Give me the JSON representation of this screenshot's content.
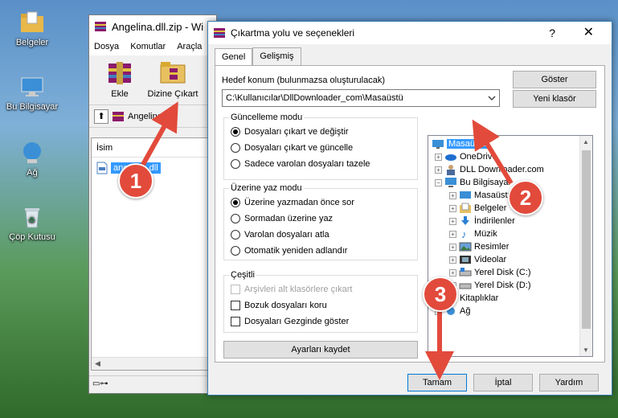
{
  "desktop": {
    "icons": [
      {
        "label": "Belgeler",
        "icon": "folder-icon"
      },
      {
        "label": "Bu Bilgisayar",
        "icon": "computer-icon"
      },
      {
        "label": "Ağ",
        "icon": "network-icon"
      },
      {
        "label": "Çöp Kutusu",
        "icon": "recycle-bin-icon"
      }
    ]
  },
  "rar": {
    "title": "Angelina.dll.zip - Wi",
    "menu": [
      "Dosya",
      "Komutlar",
      "Araçla"
    ],
    "toolbar": {
      "add_label": "Ekle",
      "extract_label": "Dizine Çıkart"
    },
    "address": "Angelina.dll",
    "column_name": "İsim",
    "file_name": "angelina.dll"
  },
  "dialog": {
    "title": "Çıkartma yolu ve seçenekleri",
    "help": "?",
    "close": "✕",
    "tabs": [
      "Genel",
      "Gelişmiş"
    ],
    "dest_label": "Hedef konum (bulunmazsa oluşturulacak)",
    "dest_value": "C:\\Kullanıcılar\\DllDownloader_com\\Masaüstü",
    "show_button": "Göster",
    "new_folder_button": "Yeni klasör",
    "update_group": {
      "title": "Güncelleme modu",
      "options": [
        "Dosyaları çıkart ve değiştir",
        "Dosyaları çıkart ve güncelle",
        "Sadece varolan dosyaları tazele"
      ],
      "selected": 0
    },
    "overwrite_group": {
      "title": "Üzerine yaz modu",
      "options": [
        "Üzerine yazmadan önce sor",
        "Sormadan üzerine yaz",
        "Varolan dosyaları atla",
        "Otomatik yeniden adlandır"
      ],
      "selected": 0
    },
    "misc_group": {
      "title": "Çeşitli",
      "options": [
        "Arşivleri alt klasörlere çıkart",
        "Bozuk dosyaları koru",
        "Dosyaları Gezginde göster"
      ]
    },
    "save_settings_button": "Ayarları kaydet",
    "tree": [
      {
        "label": "Masaüstü",
        "selected": true
      },
      {
        "label": "OneDrive"
      },
      {
        "label": "DLL Downloader.com"
      },
      {
        "label": "Bu Bilgisayar"
      },
      {
        "label": "Masaüstü"
      },
      {
        "label": "Belgeler"
      },
      {
        "label": "İndirilenler"
      },
      {
        "label": "Müzik"
      },
      {
        "label": "Resimler"
      },
      {
        "label": "Videolar"
      },
      {
        "label": "Yerel Disk (C:)"
      },
      {
        "label": "Yerel Disk (D:)"
      },
      {
        "label": "Kitaplıklar"
      },
      {
        "label": "Ağ"
      }
    ],
    "ok_button": "Tamam",
    "cancel_button": "İptal",
    "help_button": "Yardım"
  },
  "annotations": {
    "step1": "1",
    "step2": "2",
    "step3": "3",
    "color": "#e24a3b"
  }
}
